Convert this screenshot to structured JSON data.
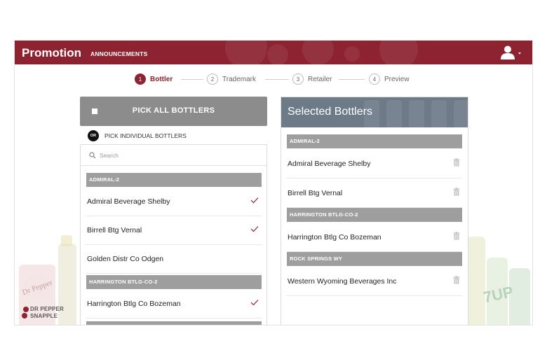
{
  "header": {
    "title": "Promotion",
    "subtitle": "ANNOUNCEMENTS",
    "bg_color": "#8d2331"
  },
  "steps": [
    {
      "num": "1",
      "label": "Bottler",
      "active": true
    },
    {
      "num": "2",
      "label": "Trademark",
      "active": false
    },
    {
      "num": "3",
      "label": "Retailer",
      "active": false
    },
    {
      "num": "4",
      "label": "Preview",
      "active": false
    }
  ],
  "left": {
    "pick_all_label": "PICK ALL BOTTLERS",
    "or_label": "OR",
    "pick_individual_label": "PICK INDIVIDUAL BOTTLERS",
    "search_placeholder": "Search",
    "groups": [
      {
        "label": "ADMIRAL-2",
        "items": [
          {
            "name": "Admiral Beverage Shelby",
            "checked": true
          },
          {
            "name": "Birrell Btg Vernal",
            "checked": true
          },
          {
            "name": "Golden Distr Co Odgen",
            "checked": false
          }
        ]
      },
      {
        "label": "HARRINGTON BTLG-CO-2",
        "items": [
          {
            "name": "Harrington Btlg Co Bozeman",
            "checked": true
          }
        ]
      }
    ]
  },
  "right": {
    "title": "Selected Bottlers",
    "header_color": "#6d7a88",
    "groups": [
      {
        "label": "ADMIRAL-2",
        "items": [
          {
            "name": "Admiral Beverage Shelby"
          },
          {
            "name": "Birrell Btg Vernal"
          }
        ]
      },
      {
        "label": "HARRINGTON BTLG-CO-2",
        "items": [
          {
            "name": "Harrington Btlg Co Bozeman"
          }
        ]
      },
      {
        "label": "ROCK SPRINGS WY",
        "items": [
          {
            "name": "Western Wyoming Beverages Inc"
          }
        ]
      }
    ]
  },
  "brand": {
    "logo_line1": "DR PEPPER",
    "logo_line2": "SNAPPLE"
  },
  "icons": {
    "user": "user-icon",
    "caret": "caret-down-icon",
    "search": "search-icon",
    "check": "check-icon",
    "trash": "trash-icon"
  },
  "colors": {
    "accent": "#8d2331",
    "group_bg": "#9e9e9e",
    "pick_all_bg": "#8c8c8c"
  }
}
